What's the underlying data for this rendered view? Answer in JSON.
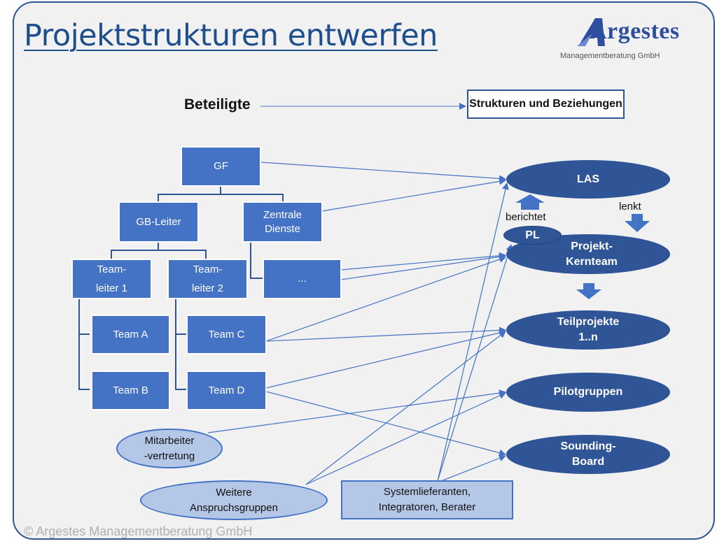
{
  "title": "Projektstrukturen entwerfen",
  "logo": {
    "name": "Argestes",
    "subtitle": "Managementberatung GmbH"
  },
  "header_row": {
    "left_label": "Beteiligte",
    "right_box": "Strukturen und Beziehungen"
  },
  "org_chart": {
    "gf": "GF",
    "gb_leiter": "GB-Leiter",
    "zentrale_dienste": "Zentrale\nDienste",
    "teamleiter1": "Team-\nleiter 1",
    "teamleiter2": "Team-\nleiter 2",
    "more": "...",
    "team_a": "Team A",
    "team_b": "Team B",
    "team_c": "Team C",
    "team_d": "Team D"
  },
  "stakeholders": {
    "mitarbeitervertretung": "Mitarbeiter\n-vertretung",
    "weitere": "Weitere\nAnspruchsgruppen",
    "systemlieferanten": "Systemlieferanten,\nIntegratoren, Berater"
  },
  "project_structure": {
    "las": "LAS",
    "pl": "PL",
    "kernteam": "Projekt-\nKernteam",
    "teilprojekte": "Teilprojekte\n1..n",
    "pilotgruppen": "Pilotgruppen",
    "sounding_board": "Sounding-\nBoard",
    "berichtet": "berichtet",
    "lenkt": "lenkt"
  },
  "copyright": "© Argestes Managementberatung GmbH",
  "colors": {
    "box": "#4472c4",
    "ellipse": "#2f5597",
    "light": "#b4c7e7",
    "line": "#4472c4",
    "title": "#1f4e8c"
  }
}
